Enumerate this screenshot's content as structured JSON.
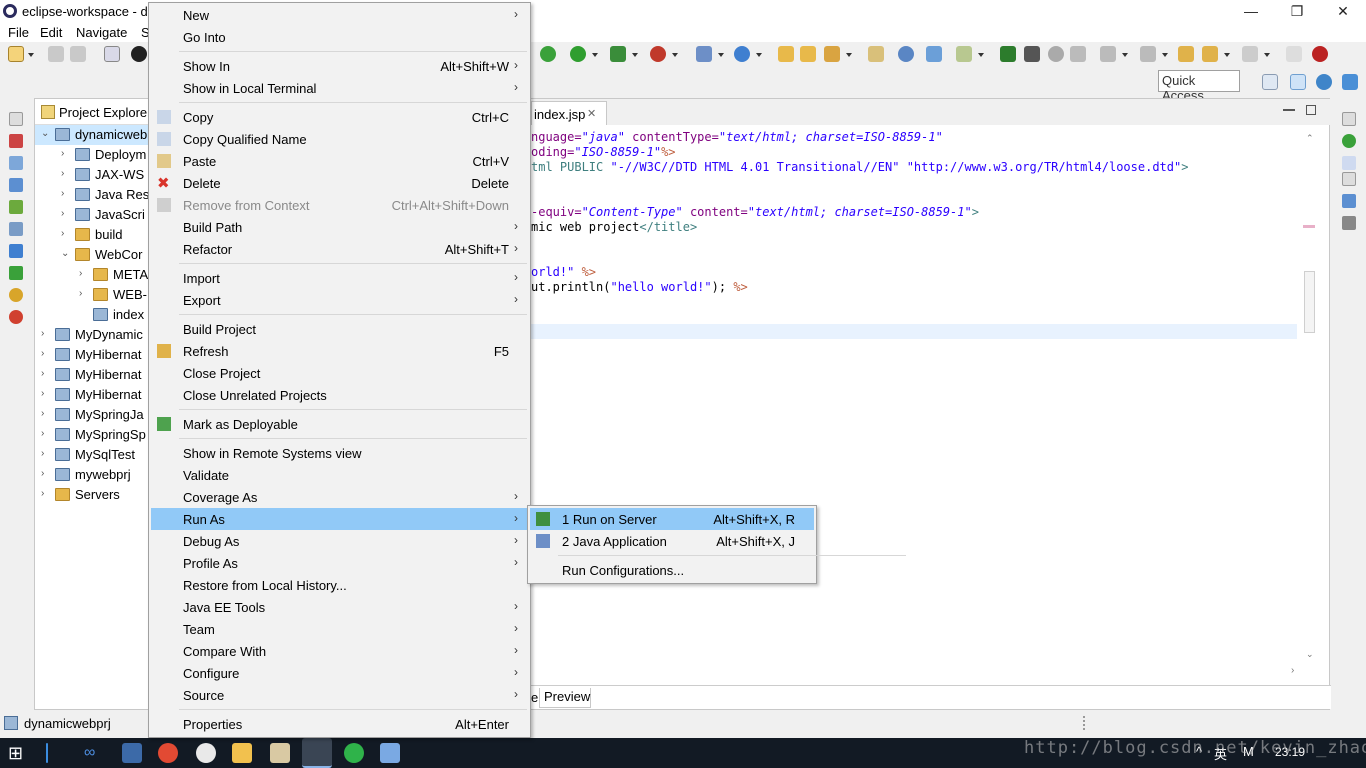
{
  "window": {
    "title": "eclipse-workspace - d",
    "controls": [
      "—",
      "❐",
      "✕"
    ]
  },
  "menubar": [
    "File",
    "Edit",
    "Navigate",
    "S"
  ],
  "quick_access": "Quick Access",
  "explorer": {
    "tab_label": "Project Explore",
    "tree": [
      {
        "label": "dynamicweb",
        "twisty": "⌄",
        "icon": "project-icon",
        "selected": true
      },
      {
        "label": "Deploym",
        "twisty": "›",
        "icon": "deployment-icon"
      },
      {
        "label": "JAX-WS",
        "twisty": "›",
        "icon": "jaxws-icon"
      },
      {
        "label": "Java Res",
        "twisty": "›",
        "icon": "java-resources-icon"
      },
      {
        "label": "JavaScri",
        "twisty": "›",
        "icon": "javascript-icon"
      },
      {
        "label": "build",
        "twisty": "›",
        "icon": "folder-icon"
      },
      {
        "label": "WebCor",
        "twisty": "⌄",
        "icon": "folder-icon"
      },
      {
        "label": "META",
        "twisty": "›",
        "icon": "folder-icon"
      },
      {
        "label": "WEB-",
        "twisty": "›",
        "icon": "folder-icon"
      },
      {
        "label": "index",
        "twisty": "",
        "icon": "jsp-file-icon"
      },
      {
        "label": "MyDynamic",
        "twisty": "›",
        "icon": "project-icon"
      },
      {
        "label": "MyHibernat",
        "twisty": "›",
        "icon": "project-icon"
      },
      {
        "label": "MyHibernat",
        "twisty": "›",
        "icon": "project-icon"
      },
      {
        "label": "MyHibernat",
        "twisty": "›",
        "icon": "project-icon"
      },
      {
        "label": "MySpringJa",
        "twisty": "›",
        "icon": "project-icon"
      },
      {
        "label": "MySpringSp",
        "twisty": "›",
        "icon": "project-icon"
      },
      {
        "label": "MySqlTest",
        "twisty": "›",
        "icon": "project-icon"
      },
      {
        "label": "mywebprj",
        "twisty": "›",
        "icon": "project-icon"
      },
      {
        "label": "Servers",
        "twisty": "›",
        "icon": "folder-icon"
      }
    ]
  },
  "editor": {
    "tab_label": "index.jsp",
    "tab_close": "✕",
    "bottom_tabs": [
      "e",
      "Preview"
    ],
    "lines": [
      {
        "parts": [
          [
            "nguage=",
            "kw"
          ],
          [
            "\"java\"",
            "st"
          ],
          [
            " contentType=",
            "kw"
          ],
          [
            "\"text/html; charset=ISO-8859-1\"",
            "st"
          ]
        ]
      },
      {
        "parts": [
          [
            "oding=",
            "kw"
          ],
          [
            "\"ISO-8859-1\"",
            "st"
          ],
          [
            "%>",
            "jsp"
          ]
        ]
      },
      {
        "parts": [
          [
            "tml PUBLIC ",
            "tg"
          ],
          [
            "\"-//W3C//DTD HTML 4.01 Transitional//EN\" \"http://www.w3.org/TR/html4/loose.dtd\"",
            "str"
          ],
          [
            ">",
            "tg"
          ]
        ]
      },
      {
        "parts": []
      },
      {
        "parts": []
      },
      {
        "parts": [
          [
            "-equiv=",
            "kw"
          ],
          [
            "\"Content-Type\"",
            "st"
          ],
          [
            " content=",
            "kw"
          ],
          [
            "\"text/html; charset=ISO-8859-1\"",
            "st"
          ],
          [
            ">",
            "tg"
          ]
        ]
      },
      {
        "parts": [
          [
            "mic web project",
            ""
          ],
          [
            "</title>",
            "tg"
          ]
        ]
      },
      {
        "parts": []
      },
      {
        "parts": []
      },
      {
        "parts": [
          [
            "orld!\" ",
            "str"
          ],
          [
            "%>",
            "jsp"
          ]
        ]
      },
      {
        "parts": [
          [
            "ut.println(",
            ""
          ],
          [
            "\"hello world!\"",
            "str"
          ],
          [
            "); ",
            ""
          ],
          [
            "%>",
            "jsp"
          ]
        ]
      }
    ]
  },
  "status": {
    "selected_item": "dynamicwebprj"
  },
  "context_menu": {
    "items": [
      {
        "label": "New",
        "sub": true
      },
      {
        "label": "Go Into"
      },
      {
        "sep": true
      },
      {
        "label": "Show In",
        "accel": "Alt+Shift+W",
        "sub": true
      },
      {
        "label": "Show in Local Terminal",
        "sub": true
      },
      {
        "sep": true
      },
      {
        "label": "Copy",
        "accel": "Ctrl+C",
        "icon": "copy-icon"
      },
      {
        "label": "Copy Qualified Name",
        "icon": "copy-qualified-icon"
      },
      {
        "label": "Paste",
        "accel": "Ctrl+V",
        "icon": "paste-icon"
      },
      {
        "label": "Delete",
        "accel": "Delete",
        "icon": "delete-icon"
      },
      {
        "label": "Remove from Context",
        "accel": "Ctrl+Alt+Shift+Down",
        "disabled": true,
        "icon": "remove-context-icon"
      },
      {
        "label": "Build Path",
        "sub": true
      },
      {
        "label": "Refactor",
        "accel": "Alt+Shift+T",
        "sub": true
      },
      {
        "sep": true
      },
      {
        "label": "Import",
        "sub": true
      },
      {
        "label": "Export",
        "sub": true
      },
      {
        "sep": true
      },
      {
        "label": "Build Project"
      },
      {
        "label": "Refresh",
        "accel": "F5",
        "icon": "refresh-icon"
      },
      {
        "label": "Close Project"
      },
      {
        "label": "Close Unrelated Projects"
      },
      {
        "sep": true
      },
      {
        "label": "Mark as Deployable",
        "icon": "deployable-icon"
      },
      {
        "sep": true
      },
      {
        "label": "Show in Remote Systems view"
      },
      {
        "label": "Validate"
      },
      {
        "label": "Coverage As",
        "sub": true
      },
      {
        "label": "Run As",
        "sub": true,
        "highlight": true
      },
      {
        "label": "Debug As",
        "sub": true
      },
      {
        "label": "Profile As",
        "sub": true
      },
      {
        "label": "Restore from Local History..."
      },
      {
        "label": "Java EE Tools",
        "sub": true
      },
      {
        "label": "Team",
        "sub": true
      },
      {
        "label": "Compare With",
        "sub": true
      },
      {
        "label": "Configure",
        "sub": true
      },
      {
        "label": "Source",
        "sub": true
      },
      {
        "sep": true
      },
      {
        "label": "Properties",
        "accel": "Alt+Enter"
      }
    ]
  },
  "run_as_submenu": {
    "items": [
      {
        "label": "1 Run on Server",
        "accel": "Alt+Shift+X, R",
        "highlight": true,
        "icon": "run-on-server-icon"
      },
      {
        "label": "2 Java Application",
        "accel": "Alt+Shift+X, J",
        "icon": "java-application-icon"
      },
      {
        "sep": true
      },
      {
        "label": "Run Configurations..."
      }
    ]
  },
  "taskbar": {
    "clock": "23:19",
    "ime": "英",
    "ime_mode": "M"
  },
  "watermark": "http://blog.csdn.net/kevin_zhaowang",
  "colors": {
    "menu_highlight": "#91c9f7",
    "menu_bg": "#f2f2f2",
    "taskbar": "#121a24",
    "selection": "#cce8ff"
  }
}
